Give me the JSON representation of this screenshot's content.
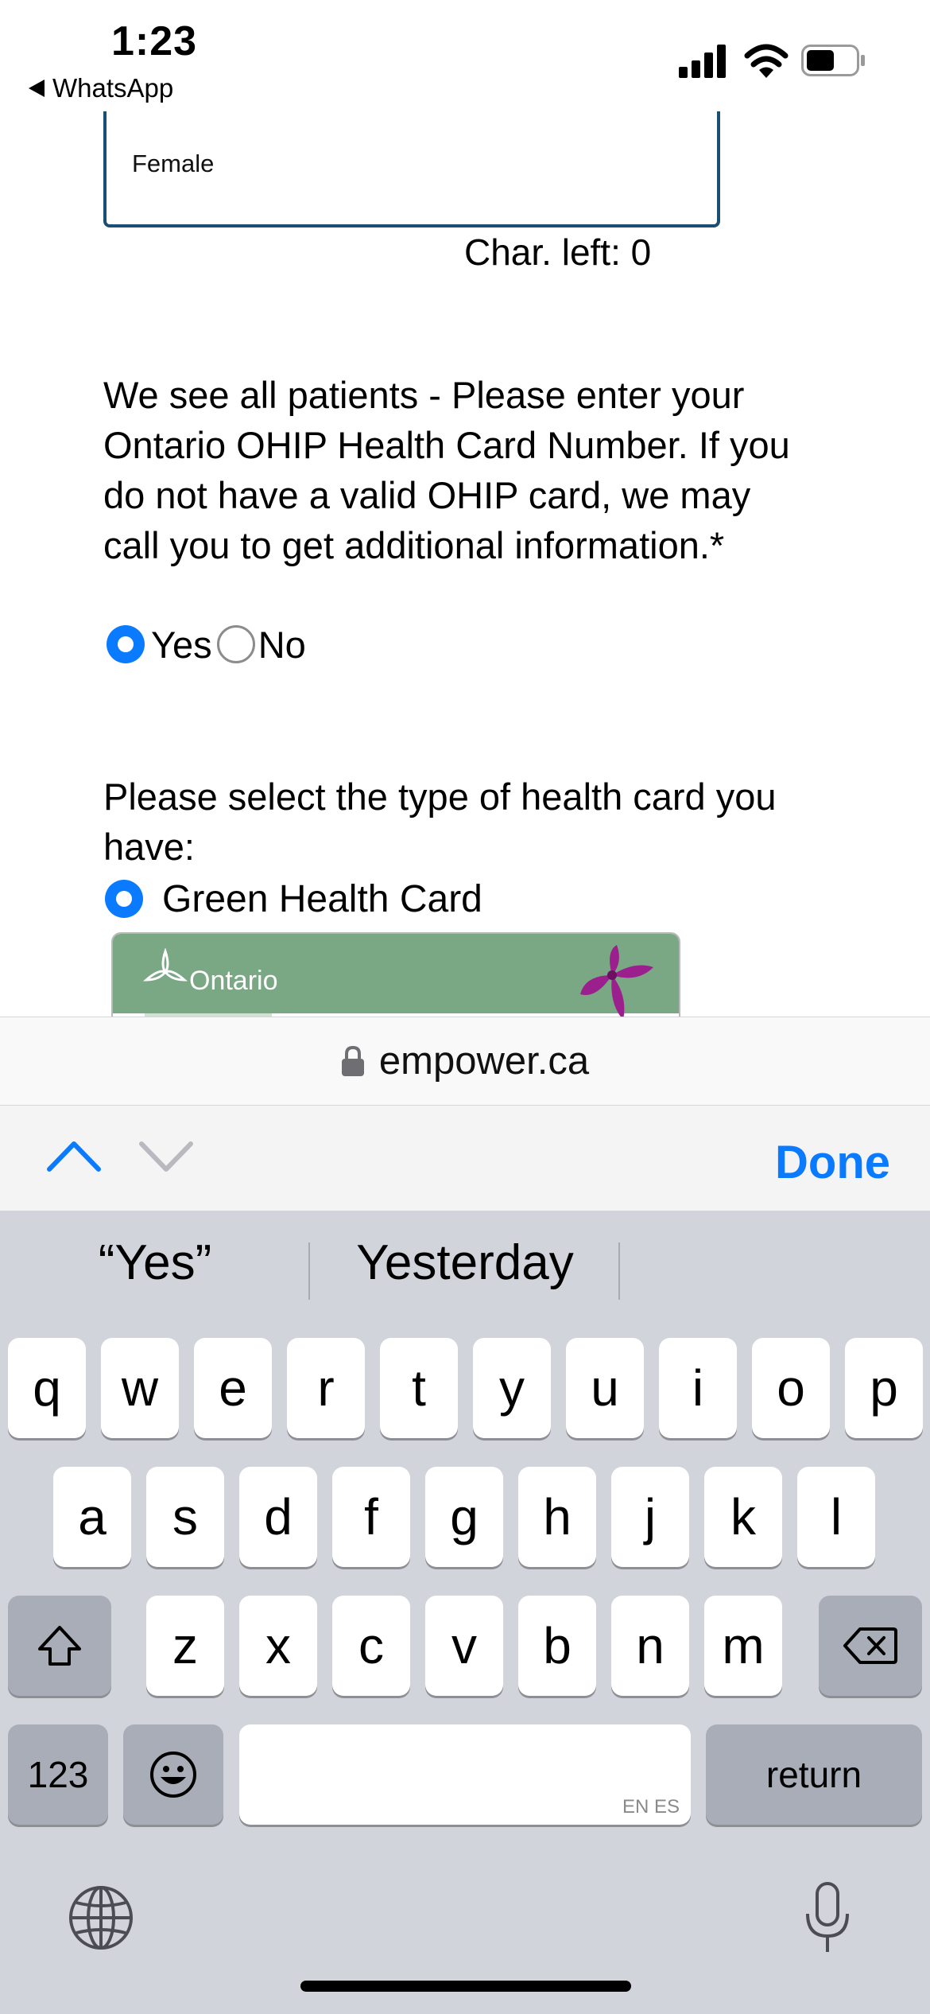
{
  "status_bar": {
    "time": "1:23",
    "back_app": "WhatsApp"
  },
  "form": {
    "gender_value": "Female",
    "char_left": "Char. left: 0",
    "ohip_question": "We see all patients - Please enter your Ontario OHIP Health Card Number. If you do not have a valid OHIP card, we may call you to get additional information.*",
    "ohip_options": [
      {
        "label": "Yes",
        "selected": true
      },
      {
        "label": "No",
        "selected": false
      }
    ],
    "card_type_question": "Please select the type of health card you have:",
    "card_type_option": {
      "label": "Green Health Card",
      "selected": true
    },
    "card_image_text": "Ontario"
  },
  "browser": {
    "url": "empower.ca"
  },
  "accessory": {
    "done_label": "Done"
  },
  "keyboard": {
    "suggestions": [
      "“Yes”",
      "Yesterday",
      ""
    ],
    "row1": [
      "q",
      "w",
      "e",
      "r",
      "t",
      "y",
      "u",
      "i",
      "o",
      "p"
    ],
    "row2": [
      "a",
      "s",
      "d",
      "f",
      "g",
      "h",
      "j",
      "k",
      "l"
    ],
    "row3": [
      "z",
      "x",
      "c",
      "v",
      "b",
      "n",
      "m"
    ],
    "numbers_label": "123",
    "return_label": "return",
    "space_lang_hint": "EN ES"
  },
  "colors": {
    "accent": "#0a7aff",
    "textarea_border": "#1b4f72",
    "card_green": "#7aa884",
    "keyboard_bg": "#d1d4db"
  }
}
